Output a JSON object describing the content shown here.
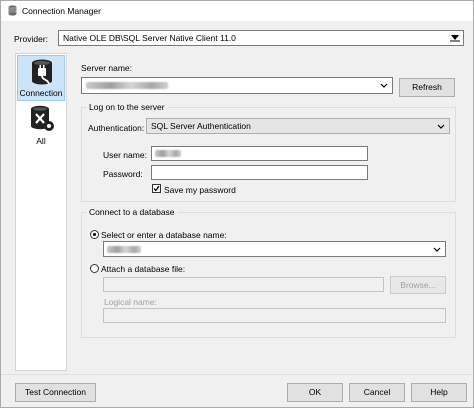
{
  "window": {
    "title": "Connection Manager"
  },
  "provider": {
    "label": "Provider:",
    "value": "Native OLE DB\\SQL Server Native Client 11.0"
  },
  "nav": {
    "items": [
      {
        "label": "Connection",
        "icon": "connection-plug-icon"
      },
      {
        "label": "All",
        "icon": "all-properties-icon"
      }
    ]
  },
  "server": {
    "label": "Server name:",
    "refresh_label": "Refresh"
  },
  "logon": {
    "group_label": "Log on to the server",
    "auth_label": "Authentication:",
    "auth_value": "SQL Server Authentication",
    "username_label": "User name:",
    "password_label": "Password:",
    "save_password_label": "Save my password",
    "save_password_checked": true
  },
  "database": {
    "group_label": "Connect to a database",
    "select_label": "Select or enter a database name:",
    "attach_label": "Attach a database file:",
    "browse_label": "Browse...",
    "logical_name_label": "Logical name:"
  },
  "footer": {
    "test_label": "Test Connection",
    "ok_label": "OK",
    "cancel_label": "Cancel",
    "help_label": "Help"
  }
}
